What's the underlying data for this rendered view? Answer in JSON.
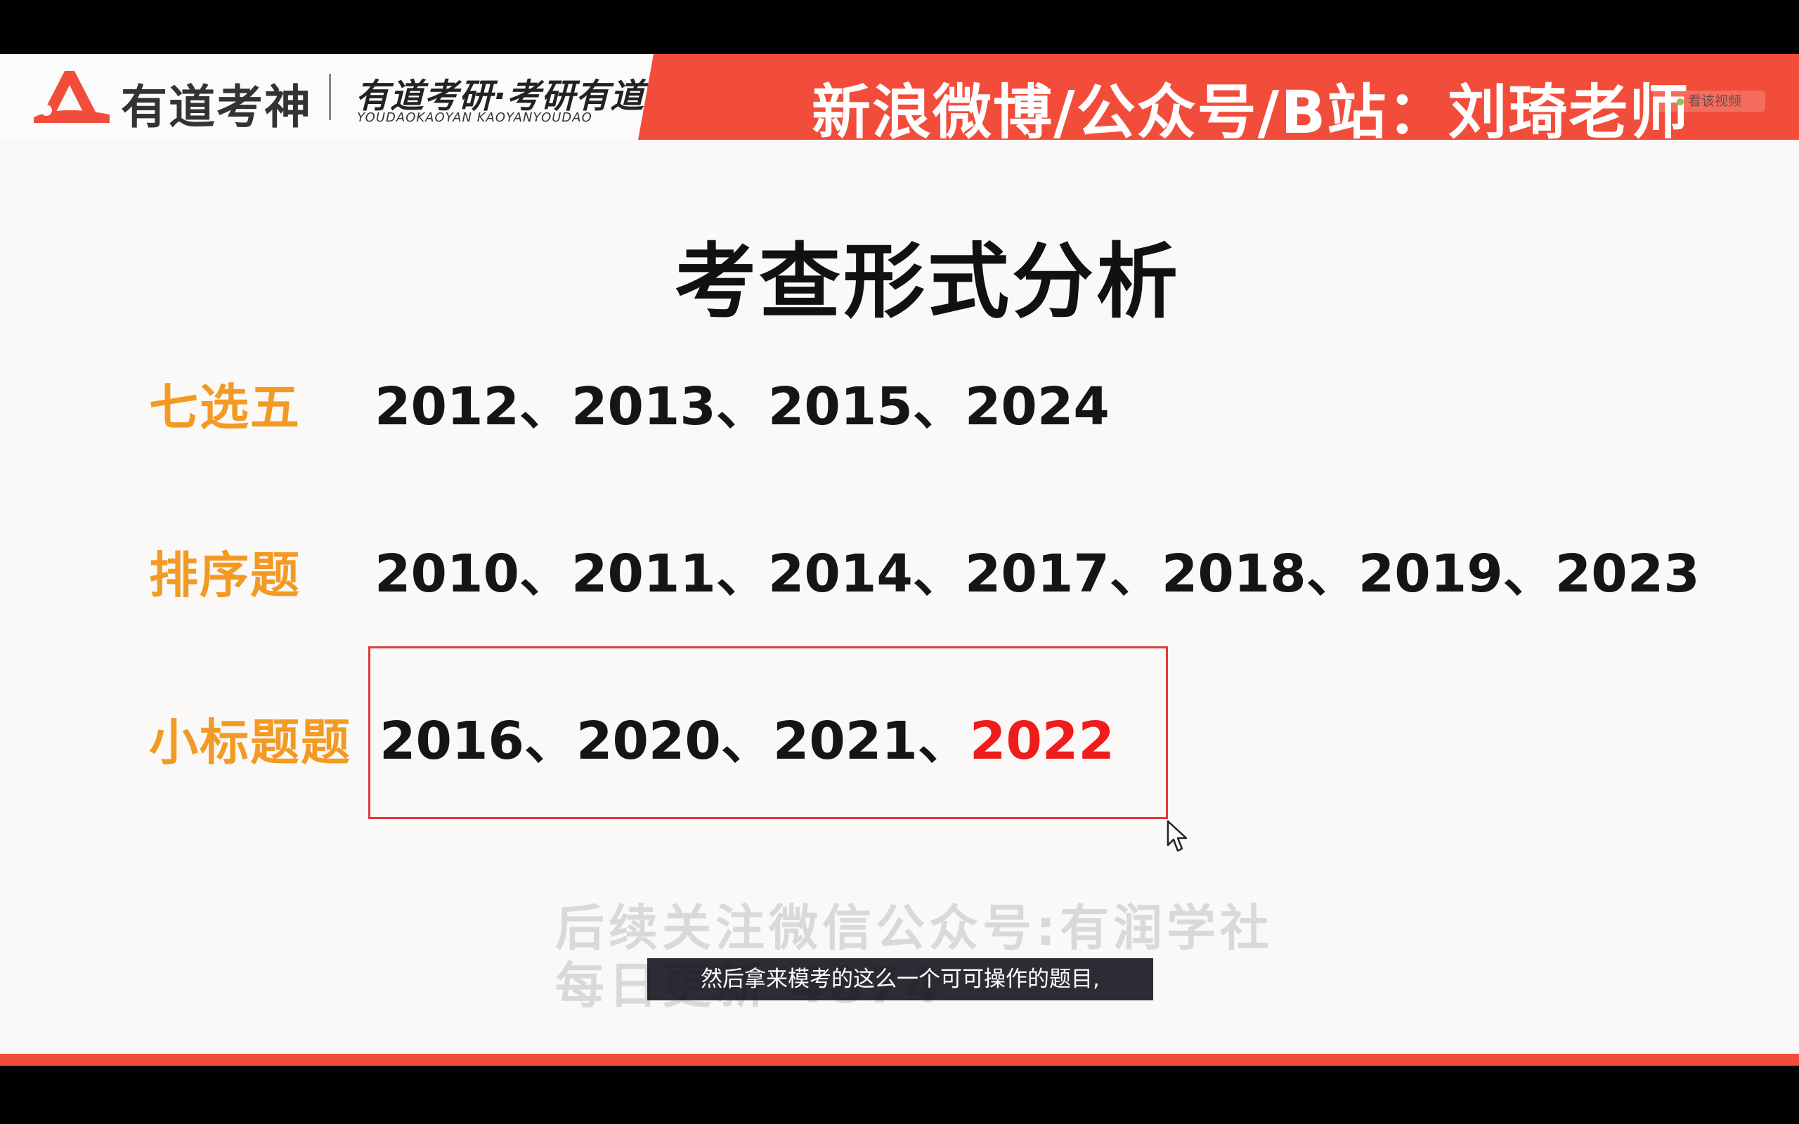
{
  "header": {
    "logo_text": "有道考神",
    "brand_cn": "有道考研·考研有道",
    "brand_en": "YOUDAOKAOYAN   KAOYANYOUDAO",
    "title": "新浪微博/公众号/B站：刘琦老师",
    "watch_label": "看该视频",
    "colors": {
      "band": "#f24d3b",
      "logo": "#f24d3b"
    }
  },
  "slide": {
    "title": "考查形式分析",
    "rows": [
      {
        "label": "七选五",
        "years_text": "2012、2013、2015、2024"
      },
      {
        "label": "排序题",
        "years_text": "2010、2011、2014、2017、2018、2019、2023"
      },
      {
        "label": "小标题题",
        "years_prefix": "2016、2020、2021、",
        "highlight_year": "2022"
      }
    ],
    "colors": {
      "label": "#f39a24",
      "highlight": "#ee1c1c",
      "box": "#e23a3a"
    }
  },
  "watermark": {
    "line1": "后续关注微信公众号:有润学社",
    "line2": "每日更新     4874"
  },
  "subtitle": {
    "text": "然后拿来模考的这么一个可可操作的题目,"
  }
}
